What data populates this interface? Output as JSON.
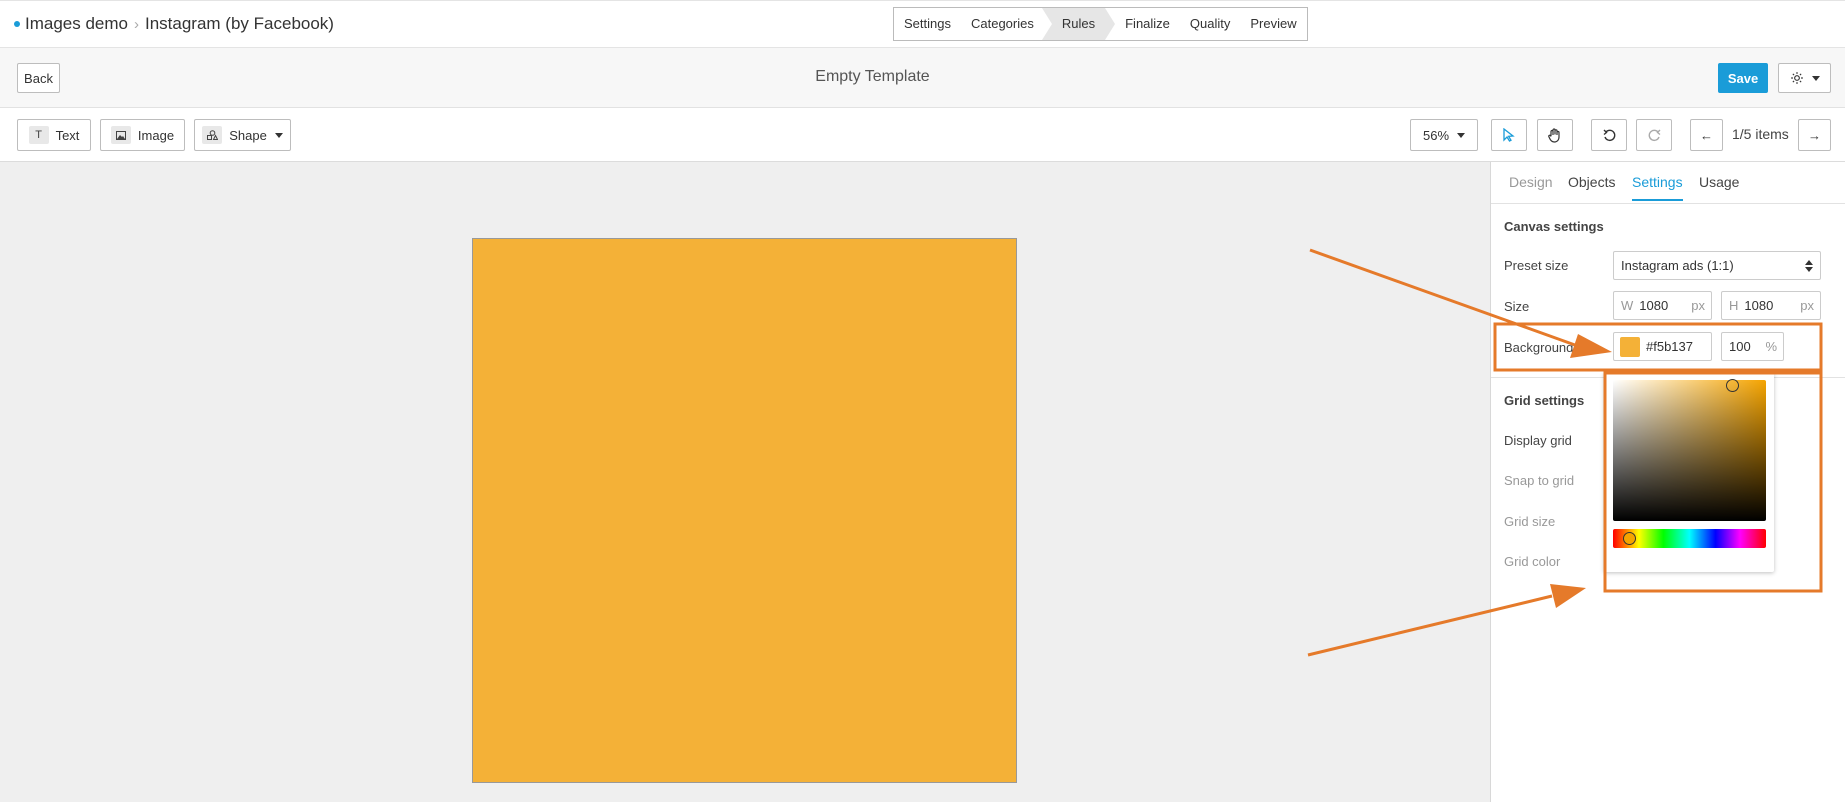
{
  "breadcrumb": {
    "project": "Images demo",
    "template": "Instagram (by Facebook)"
  },
  "steps": [
    "Settings",
    "Categories",
    "Rules",
    "Finalize",
    "Quality",
    "Preview"
  ],
  "active_step": "Rules",
  "titlebar": {
    "back_label": "Back",
    "title": "Empty Template",
    "save_label": "Save"
  },
  "toolbar": {
    "text_label": "Text",
    "image_label": "Image",
    "shape_label": "Shape",
    "zoom": "56%",
    "pagination": "1/5 items"
  },
  "panel": {
    "tabs": [
      {
        "label": "Design",
        "state": "disabled"
      },
      {
        "label": "Objects",
        "state": "normal"
      },
      {
        "label": "Settings",
        "state": "active"
      },
      {
        "label": "Usage",
        "state": "normal"
      }
    ],
    "canvas_settings": {
      "title": "Canvas settings",
      "preset_label": "Preset size",
      "preset_value": "Instagram ads (1:1)",
      "size_label": "Size",
      "width_prefix": "W",
      "width_value": "1080",
      "width_unit": "px",
      "height_prefix": "H",
      "height_value": "1080",
      "height_unit": "px",
      "background_label": "Background",
      "background_hex": "#f5b137",
      "opacity_value": "100",
      "opacity_unit": "%"
    },
    "grid_settings": {
      "title": "Grid settings",
      "display_grid": "Display grid",
      "snap_to_grid": "Snap to grid",
      "grid_size": "Grid size",
      "grid_color": "Grid color"
    }
  },
  "colors": {
    "accent": "#1a9cd8",
    "canvas_fill": "#f4b137",
    "annotation": "#e57a2a",
    "workspace": "#efefef"
  }
}
